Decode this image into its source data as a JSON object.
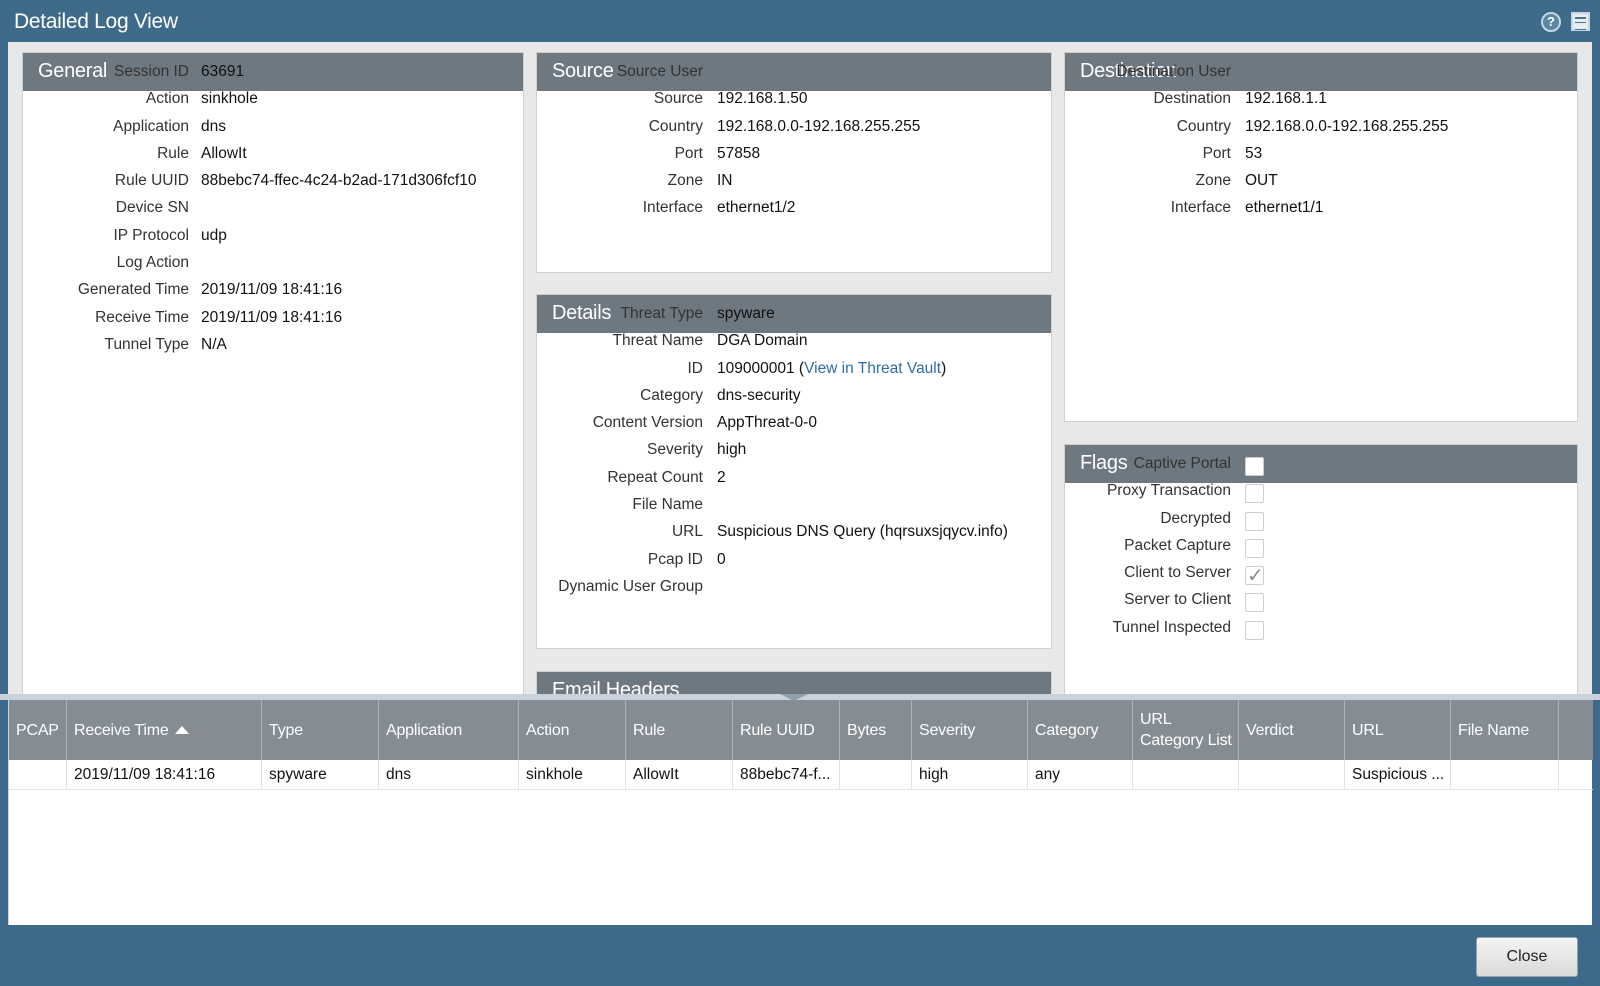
{
  "window": {
    "title": "Detailed Log View"
  },
  "general": {
    "title": "General",
    "rows": [
      {
        "label": "Session ID",
        "value": "63691"
      },
      {
        "label": "Action",
        "value": "sinkhole"
      },
      {
        "label": "Application",
        "value": "dns"
      },
      {
        "label": "Rule",
        "value": "AllowIt"
      },
      {
        "label": "Rule UUID",
        "value": "88bebc74-ffec-4c24-b2ad-171d306fcf10"
      },
      {
        "label": "Device SN",
        "value": ""
      },
      {
        "label": "IP Protocol",
        "value": "udp"
      },
      {
        "label": "Log Action",
        "value": ""
      },
      {
        "label": "Generated Time",
        "value": "2019/11/09 18:41:16"
      },
      {
        "label": "Receive Time",
        "value": "2019/11/09 18:41:16"
      },
      {
        "label": "Tunnel Type",
        "value": "N/A"
      }
    ]
  },
  "source": {
    "title": "Source",
    "rows": [
      {
        "label": "Source User",
        "value": ""
      },
      {
        "label": "Source",
        "value": "192.168.1.50"
      },
      {
        "label": "Country",
        "value": "192.168.0.0-192.168.255.255"
      },
      {
        "label": "Port",
        "value": "57858"
      },
      {
        "label": "Zone",
        "value": "IN"
      },
      {
        "label": "Interface",
        "value": "ethernet1/2"
      }
    ]
  },
  "destination": {
    "title": "Destination",
    "rows": [
      {
        "label": "Destination User",
        "value": ""
      },
      {
        "label": "Destination",
        "value": "192.168.1.1"
      },
      {
        "label": "Country",
        "value": "192.168.0.0-192.168.255.255"
      },
      {
        "label": "Port",
        "value": "53"
      },
      {
        "label": "Zone",
        "value": "OUT"
      },
      {
        "label": "Interface",
        "value": "ethernet1/1"
      }
    ]
  },
  "details": {
    "title": "Details",
    "rows": [
      {
        "label": "Threat Type",
        "value": "spyware"
      },
      {
        "label": "Threat Name",
        "value": "DGA Domain"
      },
      {
        "label": "ID",
        "value": "109000001",
        "link": "View in Threat Vault"
      },
      {
        "label": "Category",
        "value": "dns-security"
      },
      {
        "label": "Content Version",
        "value": "AppThreat-0-0"
      },
      {
        "label": "Severity",
        "value": "high"
      },
      {
        "label": "Repeat Count",
        "value": "2"
      },
      {
        "label": "File Name",
        "value": ""
      },
      {
        "label": "URL",
        "value": "Suspicious DNS Query (hqrsuxsjqycv.info)"
      },
      {
        "label": "Pcap ID",
        "value": "0"
      },
      {
        "label": "Dynamic User Group",
        "value": ""
      }
    ]
  },
  "flags": {
    "title": "Flags",
    "items": [
      {
        "label": "Captive Portal",
        "checked": false
      },
      {
        "label": "Proxy Transaction",
        "checked": false
      },
      {
        "label": "Decrypted",
        "checked": false
      },
      {
        "label": "Packet Capture",
        "checked": false
      },
      {
        "label": "Client to Server",
        "checked": true
      },
      {
        "label": "Server to Client",
        "checked": false
      },
      {
        "label": "Tunnel Inspected",
        "checked": false
      }
    ]
  },
  "email_headers": {
    "title": "Email Headers"
  },
  "table": {
    "columns": [
      "PCAP",
      "Receive Time",
      "Type",
      "Application",
      "Action",
      "Rule",
      "Rule UUID",
      "Bytes",
      "Severity",
      "Category",
      "URL Category List",
      "Verdict",
      "URL",
      "File Name"
    ],
    "sorted_column": "Receive Time",
    "rows": [
      [
        "",
        "2019/11/09 18:41:16",
        "spyware",
        "dns",
        "sinkhole",
        "AllowIt",
        "88bebc74-f...",
        "",
        "high",
        "any",
        "",
        "",
        "Suspicious ...",
        ""
      ]
    ]
  },
  "footer": {
    "close_label": "Close"
  },
  "colors": {
    "titlebar": "#3f6b8b",
    "panel_header": "#6e7880",
    "grid_header": "#858d94",
    "link": "#2f6ea6"
  }
}
